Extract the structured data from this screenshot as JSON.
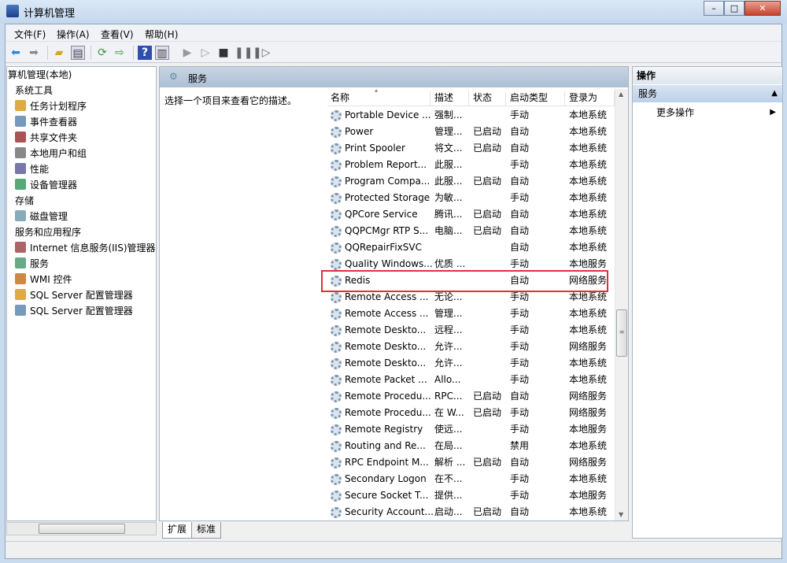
{
  "window": {
    "title": "计算机管理",
    "controls": [
      "minimize",
      "maximize",
      "close"
    ]
  },
  "menu": [
    {
      "label": "文件(F)"
    },
    {
      "label": "操作(A)"
    },
    {
      "label": "查看(V)"
    },
    {
      "label": "帮助(H)"
    }
  ],
  "toolbar": [
    "back-icon",
    "forward-icon",
    "up-folder-icon",
    "show-hide-tree-icon",
    "refresh-icon",
    "export-list-icon",
    "help-icon",
    "show-hide-action-pane-icon",
    "start-icon",
    "start-alt-icon",
    "stop-icon",
    "pause-icon",
    "resume-icon"
  ],
  "tree": [
    {
      "label": "算机管理(本地)",
      "level": 0
    },
    {
      "label": "系统工具",
      "level": 1
    },
    {
      "label": "任务计划程序",
      "level": 2,
      "icon": "clock-icon"
    },
    {
      "label": "事件查看器",
      "level": 2,
      "icon": "event-viewer-icon"
    },
    {
      "label": "共享文件夹",
      "level": 2,
      "icon": "shared-folder-icon"
    },
    {
      "label": "本地用户和组",
      "level": 2,
      "icon": "users-icon"
    },
    {
      "label": "性能",
      "level": 2,
      "icon": "performance-icon"
    },
    {
      "label": "设备管理器",
      "level": 2,
      "icon": "device-manager-icon"
    },
    {
      "label": "存储",
      "level": 1
    },
    {
      "label": "磁盘管理",
      "level": 2,
      "icon": "disk-icon"
    },
    {
      "label": "服务和应用程序",
      "level": 1
    },
    {
      "label": "Internet 信息服务(IIS)管理器",
      "level": 2,
      "icon": "iis-icon"
    },
    {
      "label": "服务",
      "level": 2,
      "icon": "services-icon",
      "selected": true
    },
    {
      "label": "WMI 控件",
      "level": 2,
      "icon": "wmi-icon"
    },
    {
      "label": "SQL Server 配置管理器",
      "level": 2,
      "icon": "sql-icon"
    },
    {
      "label": "SQL Server 配置管理器",
      "level": 2,
      "icon": "sql-icon"
    }
  ],
  "center": {
    "title": "服务",
    "description": "选择一个项目来查看它的描述。",
    "columns": [
      "名称",
      "描述",
      "状态",
      "启动类型",
      "登录为"
    ],
    "rows": [
      [
        "Portable Device ...",
        "强制...",
        "",
        "手动",
        "本地系统"
      ],
      [
        "Power",
        "管理...",
        "已启动",
        "自动",
        "本地系统"
      ],
      [
        "Print Spooler",
        "将文...",
        "已启动",
        "自动",
        "本地系统"
      ],
      [
        "Problem Report...",
        "此服...",
        "",
        "手动",
        "本地系统"
      ],
      [
        "Program Compa...",
        "此服...",
        "已启动",
        "自动",
        "本地系统"
      ],
      [
        "Protected Storage",
        "为敏...",
        "",
        "手动",
        "本地系统"
      ],
      [
        "QPCore Service",
        "腾讯...",
        "已启动",
        "自动",
        "本地系统"
      ],
      [
        "QQPCMgr RTP S...",
        "电脑...",
        "已启动",
        "自动",
        "本地系统"
      ],
      [
        "QQRepairFixSVC",
        "",
        "",
        "自动",
        "本地系统"
      ],
      [
        "Quality Windows...",
        "优质 ...",
        "",
        "手动",
        "本地服务"
      ],
      [
        "Redis",
        "",
        "",
        "自动",
        "网络服务"
      ],
      [
        "Remote Access ...",
        "无论...",
        "",
        "手动",
        "本地系统"
      ],
      [
        "Remote Access ...",
        "管理...",
        "",
        "手动",
        "本地系统"
      ],
      [
        "Remote Deskto...",
        "远程...",
        "",
        "手动",
        "本地系统"
      ],
      [
        "Remote Deskto...",
        "允许...",
        "",
        "手动",
        "网络服务"
      ],
      [
        "Remote Deskto...",
        "允许...",
        "",
        "手动",
        "本地系统"
      ],
      [
        "Remote Packet ...",
        "Allo...",
        "",
        "手动",
        "本地系统"
      ],
      [
        "Remote Procedu...",
        "RPC...",
        "已启动",
        "自动",
        "网络服务"
      ],
      [
        "Remote Procedu...",
        "在 W...",
        "已启动",
        "手动",
        "网络服务"
      ],
      [
        "Remote Registry",
        "使远...",
        "",
        "手动",
        "本地服务"
      ],
      [
        "Routing and Re...",
        "在局...",
        "",
        "禁用",
        "本地系统"
      ],
      [
        "RPC Endpoint M...",
        "解析 ...",
        "已启动",
        "自动",
        "网络服务"
      ],
      [
        "Secondary Logon",
        "在不...",
        "",
        "手动",
        "本地系统"
      ],
      [
        "Secure Socket T...",
        "提供...",
        "",
        "手动",
        "本地服务"
      ],
      [
        "Security Account...",
        "启动...",
        "已启动",
        "自动",
        "本地系统"
      ]
    ],
    "highlighted_row": "Redis",
    "highlight_color": "#e0303a",
    "tabs": [
      {
        "label": "扩展",
        "active": true
      },
      {
        "label": "标准"
      }
    ]
  },
  "actions": {
    "title": "操作",
    "section": "服务",
    "more": "更多操作"
  }
}
